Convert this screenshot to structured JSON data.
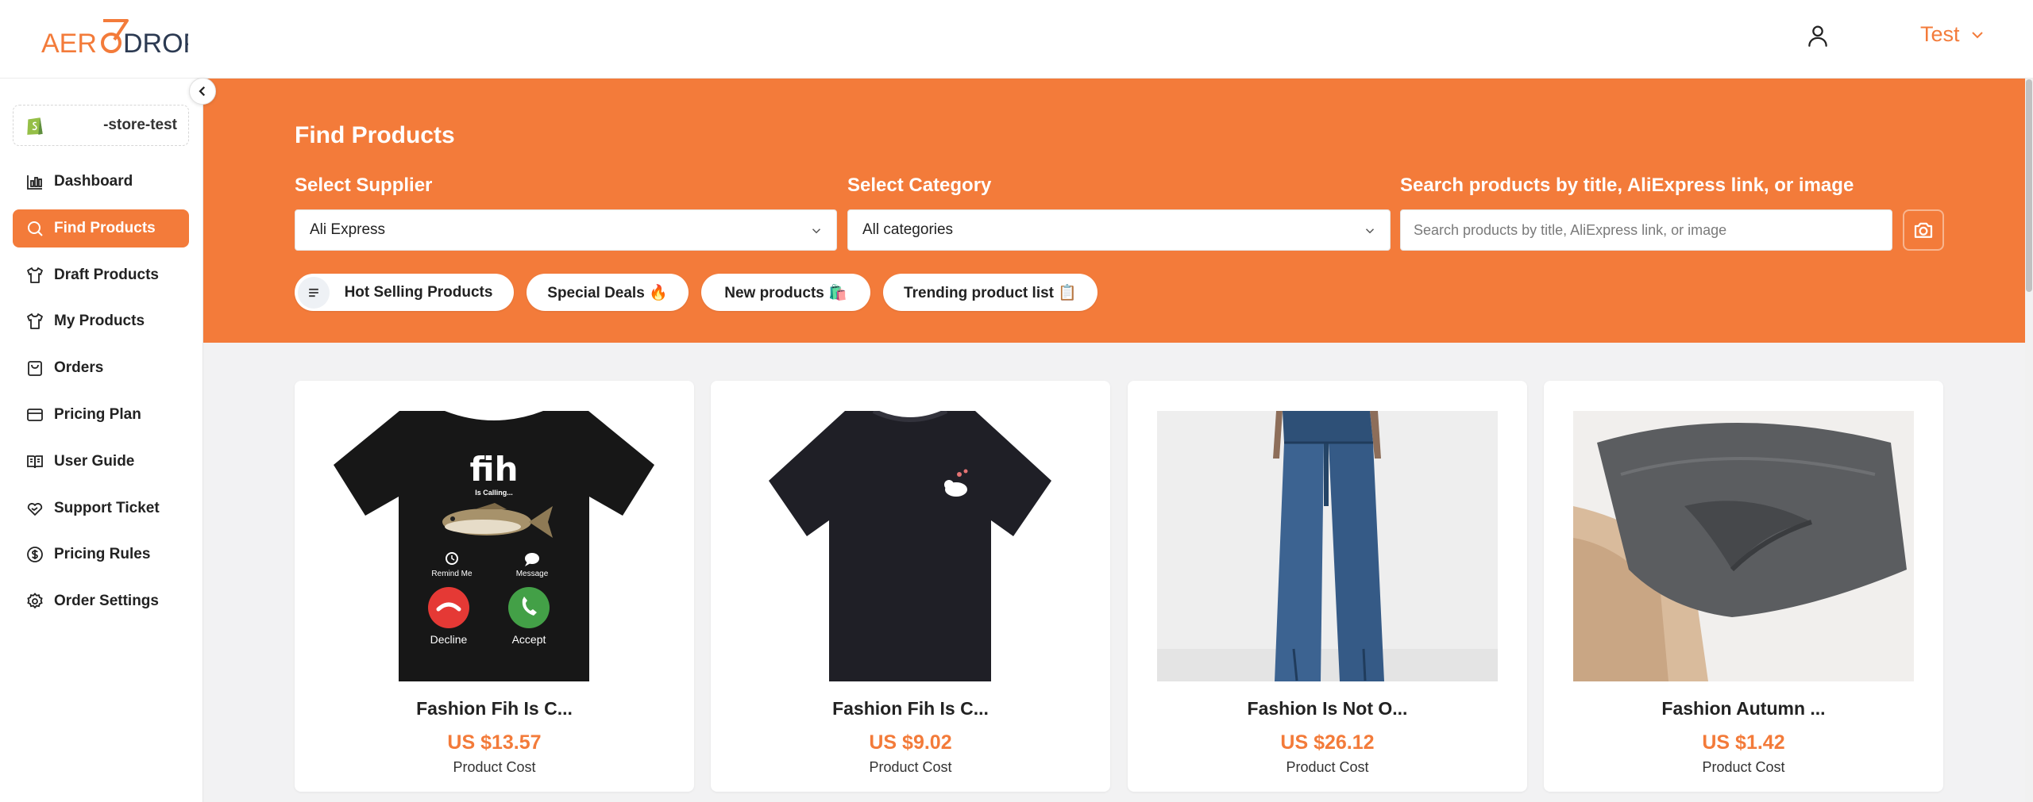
{
  "header": {
    "logo_text": "AERODROP",
    "user_name": "Test"
  },
  "sidebar": {
    "store_name": "-store-test",
    "items": [
      {
        "label": "Dashboard",
        "icon": "chart-icon"
      },
      {
        "label": "Find Products",
        "icon": "search-icon",
        "active": true
      },
      {
        "label": "Draft Products",
        "icon": "shirt-icon"
      },
      {
        "label": "My Products",
        "icon": "shirt-icon"
      },
      {
        "label": "Orders",
        "icon": "bag-icon"
      },
      {
        "label": "Pricing Plan",
        "icon": "card-icon"
      },
      {
        "label": "User Guide",
        "icon": "book-icon"
      },
      {
        "label": "Support Ticket",
        "icon": "heart-hand-icon"
      },
      {
        "label": "Pricing Rules",
        "icon": "dollar-circle-icon"
      },
      {
        "label": "Order Settings",
        "icon": "gear-icon"
      }
    ]
  },
  "banner": {
    "title": "Find Products",
    "supplier_label": "Select Supplier",
    "supplier_value": "Ali Express",
    "category_label": "Select Category",
    "category_value": "All categories",
    "search_label": "Search products by title, AliExpress link, or image",
    "search_placeholder": "Search products by title, AliExpress link, or image",
    "chips": [
      {
        "label": "Hot Selling Products"
      },
      {
        "label": "Special Deals 🔥"
      },
      {
        "label": "New products 🛍️"
      },
      {
        "label": "Trending product list 📋"
      }
    ]
  },
  "products": [
    {
      "name": "Fashion Fih Is C...",
      "price": "US $13.57",
      "cost_label": "Product Cost"
    },
    {
      "name": "Fashion Fih Is C...",
      "price": "US $9.02",
      "cost_label": "Product Cost"
    },
    {
      "name": "Fashion Is Not O...",
      "price": "US $26.12",
      "cost_label": "Product Cost"
    },
    {
      "name": "Fashion Autumn ...",
      "price": "US $1.42",
      "cost_label": "Product Cost"
    }
  ],
  "tshirt_art": {
    "big_text": "fih",
    "sub_text": "Is Calling...",
    "remind": "Remind Me",
    "message": "Message",
    "decline": "Decline",
    "accept": "Accept"
  },
  "colors": {
    "accent": "#f37b3a",
    "background": "#f2f2f3"
  }
}
